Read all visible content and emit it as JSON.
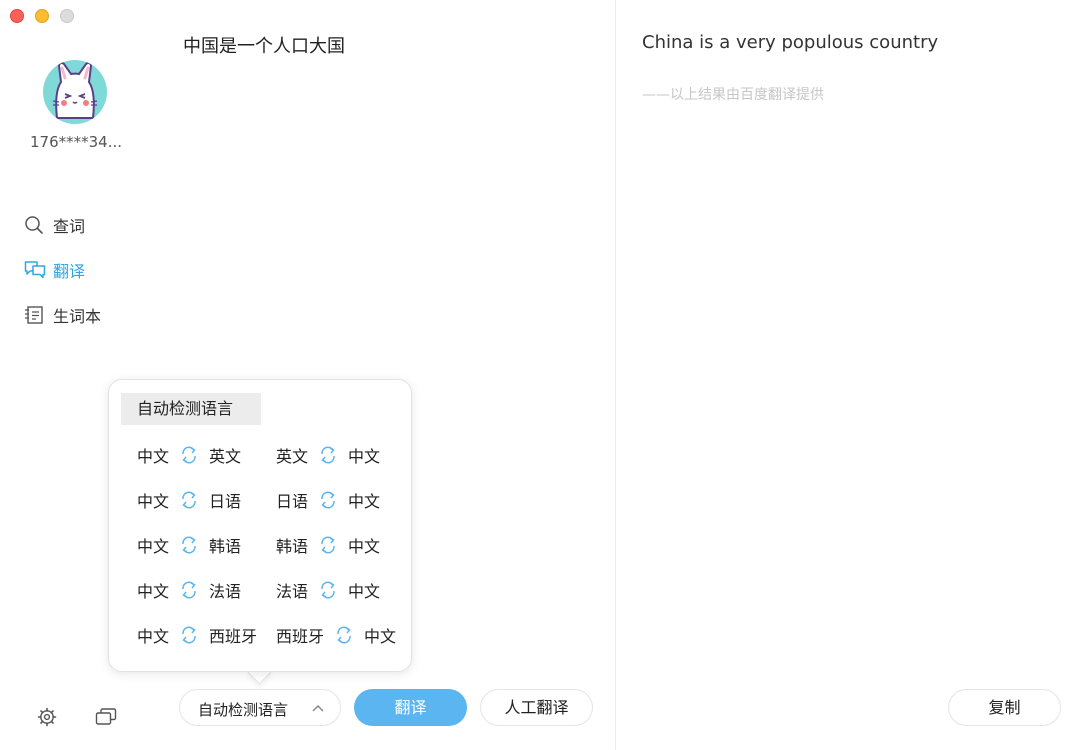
{
  "user": {
    "name": "176****34...",
    "avatar_icon": "bunny-avatar"
  },
  "nav": {
    "items": [
      {
        "label": "查词",
        "icon": "search-icon",
        "active": false
      },
      {
        "label": "翻译",
        "icon": "chat-bubbles-icon",
        "active": true
      },
      {
        "label": "生词本",
        "icon": "notebook-icon",
        "active": false
      }
    ]
  },
  "source": {
    "text": "中国是一个人口大国"
  },
  "result": {
    "text": "China is a very populous country",
    "credit": "——以上结果由百度翻译提供"
  },
  "language_menu": {
    "auto_detect": "自动检测语言",
    "pairs": [
      {
        "from": "中文",
        "to": "英文"
      },
      {
        "from": "英文",
        "to": "中文"
      },
      {
        "from": "中文",
        "to": "日语"
      },
      {
        "from": "日语",
        "to": "中文"
      },
      {
        "from": "中文",
        "to": "韩语"
      },
      {
        "from": "韩语",
        "to": "中文"
      },
      {
        "from": "中文",
        "to": "法语"
      },
      {
        "from": "法语",
        "to": "中文"
      },
      {
        "from": "中文",
        "to": "西班牙"
      },
      {
        "from": "西班牙",
        "to": "中文"
      }
    ]
  },
  "toolbar": {
    "selected_language": "自动检测语言",
    "translate_label": "翻译",
    "human_translate_label": "人工翻译",
    "copy_label": "复制"
  },
  "colors": {
    "accent": "#2ea7e0",
    "button_blue": "#5ab5f0"
  }
}
